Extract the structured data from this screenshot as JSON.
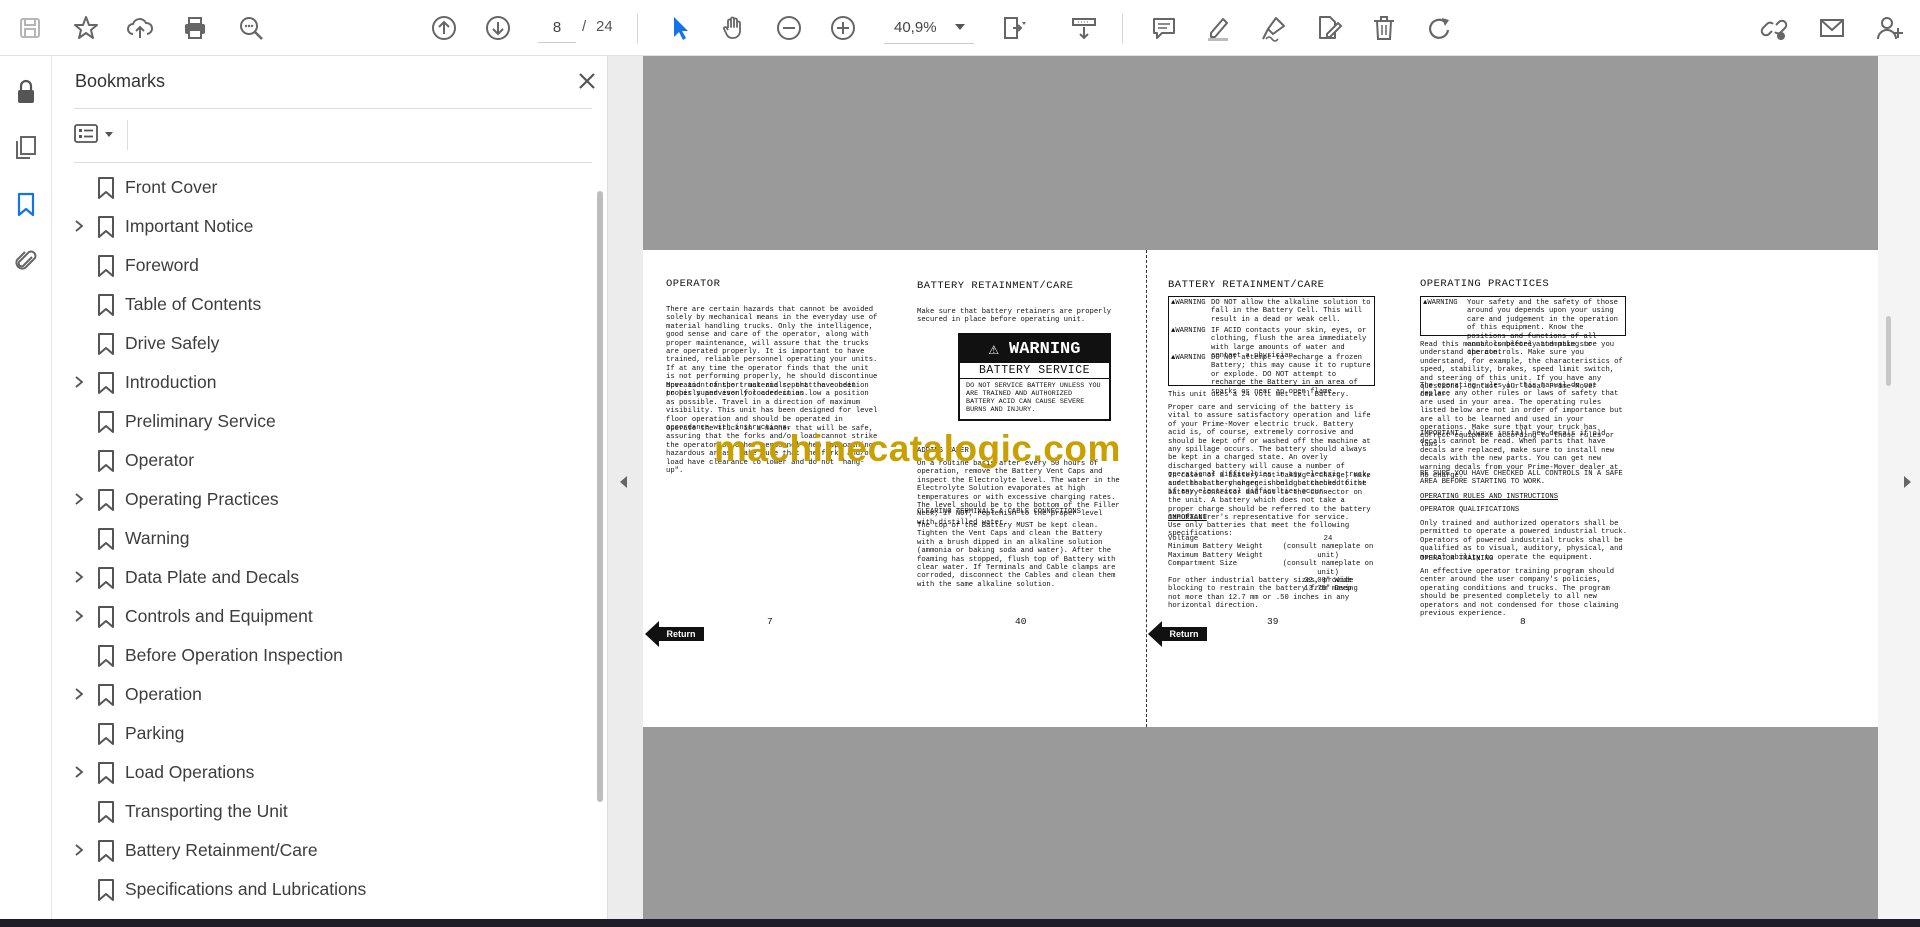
{
  "toolbar": {
    "current_page": "8",
    "page_separator": "/",
    "total_pages": "24",
    "zoom": "40,9%"
  },
  "bookmarks_panel": {
    "title": "Bookmarks",
    "items": [
      {
        "label": "Front Cover",
        "expandable": false
      },
      {
        "label": "Important Notice",
        "expandable": true
      },
      {
        "label": "Foreword",
        "expandable": false
      },
      {
        "label": "Table of Contents",
        "expandable": false
      },
      {
        "label": "Drive Safely",
        "expandable": false
      },
      {
        "label": "Introduction",
        "expandable": true
      },
      {
        "label": "Preliminary Service",
        "expandable": false
      },
      {
        "label": "Operator",
        "expandable": false
      },
      {
        "label": "Operating Practices",
        "expandable": true
      },
      {
        "label": "Warning",
        "expandable": false
      },
      {
        "label": "Data Plate and Decals",
        "expandable": true
      },
      {
        "label": "Controls and Equipment",
        "expandable": true
      },
      {
        "label": "Before Operation Inspection",
        "expandable": false
      },
      {
        "label": "Operation",
        "expandable": true
      },
      {
        "label": "Parking",
        "expandable": false
      },
      {
        "label": "Load Operations",
        "expandable": true
      },
      {
        "label": "Transporting the Unit",
        "expandable": false
      },
      {
        "label": "Battery Retainment/Care",
        "expandable": true
      },
      {
        "label": "Specifications and Lubrications",
        "expandable": false
      }
    ]
  },
  "document": {
    "watermark": "machinecatalogic.com",
    "return_label": "Return",
    "col1": {
      "heading": "OPERATOR",
      "p1": "There are certain hazards that cannot be avoided solely by mechanical means in the everyday use of material handling trucks. Only the intelligence, good sense and care of the operator, along with proper maintenance, will assure that the trucks are operated properly. It is important to have trained, reliable personnel operating your units. If at any time the operator finds that the unit is not performing properly, he should discontinue operation of the truck and report the condition to his supervisor for correction.",
      "p2": "Move and transport materials, that have been properly and evenly loaded in as low a position as possible. Travel in a direction of maximum visibility. This unit has been designed for level floor operation and should be operated in accordance with instructions.",
      "p3": "Operate the truck in a manner that will be safe, assuring that the forks and/or load cannot strike the operator or other personnel when approaching hazardous areas. Make sure that the forks and/or load have clearance to lower and do not \"hang-up\".",
      "page_no": "7"
    },
    "col2": {
      "heading": "BATTERY RETAINMENT/CARE",
      "p1": "Make sure that battery retainers are properly secured in place before operating unit.",
      "warn_title": "WARNING",
      "warn_sub": "BATTERY SERVICE",
      "warn_text": "DO NOT SERVICE BATTERY UNLESS YOU ARE TRAINED AND AUTHORIZED BATTERY ACID CAN CAUSE SEVERE BURNS AND INJURY.",
      "sub1": "ADDING WATER",
      "p2": "On a routine basis after every 50 hours of operation, remove the Battery Vent Caps and inspect the Electrolyte level. The water in the Electrolyte Solution evaporates at high temperatures or with excessive charging rates. The level should be to the bottom of the Filler Neck; if NOT, replenish to the proper level with distilled water.",
      "sub2": "CLEARING TERMINALS & CABLE CONNECTIONS",
      "p3": "The top of the Battery MUST be kept clean. Tighten the Vent Caps and clean the Battery with a brush dipped in an alkaline solution (ammonia or baking soda and water). After the foaming has stopped, flush top of Battery with clear water. If Terminals and Cable clamps are corroded, disconnect the Cables and clean them with the same alkaline solution.",
      "page_no": "40"
    },
    "col3": {
      "heading": "BATTERY RETAINMENT/CARE",
      "w1": "DO NOT allow the alkaline solution to fall in the Battery Cell. This will result in a dead or weak cell.",
      "w2": "IF ACID contacts your skin, eyes, or clothing, flush the area immediately with large amounts of water and contact a physician.",
      "w3": "DO NOT attempt to recharge a frozen Battery; this may cause it to rupture or explode. DO NOT attempt to recharge the Battery in an area of sparks or near an open flame.",
      "warn_label": "WARNING",
      "p1": "This unit uses a 24 volt wet cell Battery.",
      "p2": "Proper care and servicing of the battery is vital to assure satisfactory operation and life of your Prime-Mover electric truck. Battery acid is, of course, extremely corrosive and should be kept off or washed off the machine at any spillage occurs. The battery should always be kept in a charged state. An overly discharged battery will cause a number of operational difficulties in any electric truck, and the battery charge should be checked first if any electrical difficulties occur.",
      "p3": "In cases of a battery not taking a charge, make sure that the charger is being attached to the battery connector and not to the connector on the unit. A battery which does not take a proper charge should be referred to the battery manufacturer's representative for service.",
      "sub1": "IMPORTANT",
      "p4": "Use only batteries that meet the following specifications:",
      "spec_labels": "Voltage\nMinimum Battery Weight\nMaximum Battery Weight\nCompartment Size",
      "spec_values": "24\n(consult nameplate on unit)\n(consult nameplate on unit)\n32.00\" Wide\n13.75\" Deep",
      "p5": "For other industrial battery sizes, provide blocking to restrain the battery from moving not more than 12.7 mm or .50 inches in any horizontal direction.",
      "page_no": "39"
    },
    "col4": {
      "heading": "OPERATING PRACTICES",
      "warn_label": "WARNING",
      "w1": "Your safety and the safety of those around you depends upon your using care and judgement in the operation of this equipment. Know the positions and functions of all controls before attempting to operate.",
      "p1": "Read this manual completely and make sure you understand the controls. Make sure you understand, for example, the characteristics of speed, stability, brakes, speed limit switch, and steering of this unit. If you have any questions, contact your local Prime-Mover dealer.",
      "p2": "The operating rules in this manual do not replace any other rules or laws of safety that are used in your area. The operating rules listed below are not in order of importance but are all to be learned and used in your operations. Make sure that your truck has correct equipment according to those rules or laws.",
      "p3": "IMPORTANT: Always install new decals if old decals cannot be read. When parts that have decals are replaced, make sure to install new decals with the new parts. You can get new warning decals from your Prime-Mover dealer at no charge.",
      "p4": "BE SURE YOU HAVE CHECKED ALL CONTROLS IN A SAFE AREA BEFORE STARTING TO WORK.",
      "sub1": "OPERATING RULES AND INSTRUCTIONS",
      "sub2": "OPERATOR QUALIFICATIONS",
      "p5": "Only trained and authorized operators shall be permitted to operate a powered industrial truck. Operators of powered industrial trucks shall be qualified as to visual, auditory, physical, and mental ability to operate the equipment.",
      "sub3": "OPERATOR TRAINING",
      "p6": "An effective operator training program should center around the user company's policies, operating conditions and trucks. The program should be presented completely to all new operators and not condensed for those claiming previous experience.",
      "page_no": "8"
    }
  }
}
